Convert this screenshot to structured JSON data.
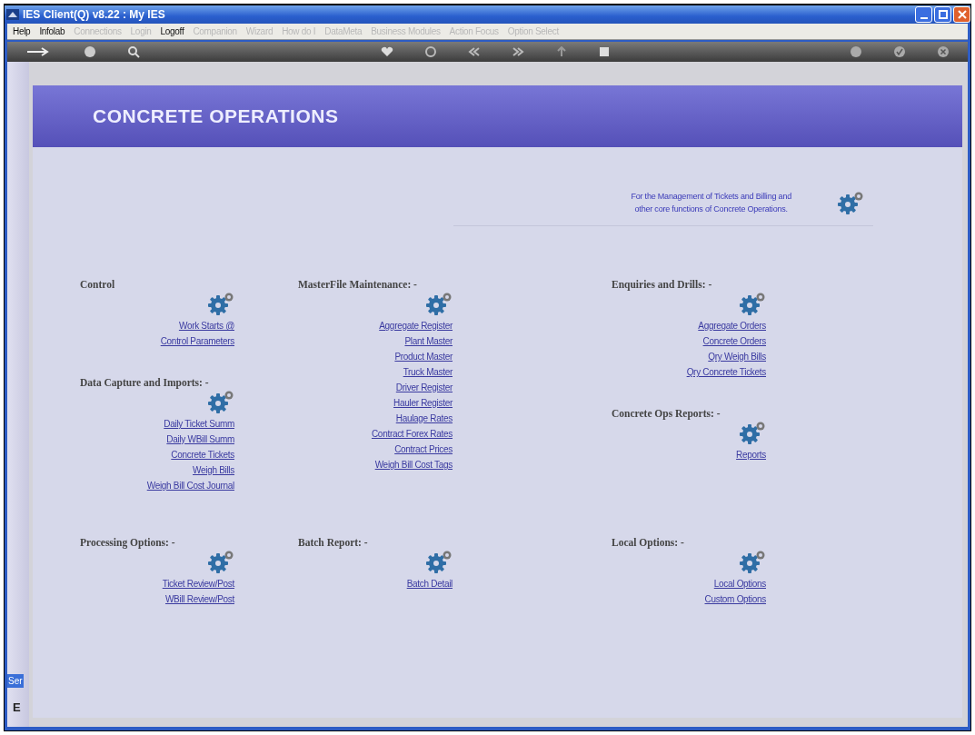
{
  "window": {
    "title": "IES Client(Q) v8.22 : My IES"
  },
  "menu": [
    {
      "label": "Help",
      "disabled": false
    },
    {
      "label": "Infolab",
      "disabled": false
    },
    {
      "label": "Connections",
      "disabled": true
    },
    {
      "label": "Login",
      "disabled": true
    },
    {
      "label": "Logoff",
      "disabled": false
    },
    {
      "label": "Companion",
      "disabled": true
    },
    {
      "label": "Wizard",
      "disabled": true
    },
    {
      "label": "How do I",
      "disabled": true
    },
    {
      "label": "DataMeta",
      "disabled": true
    },
    {
      "label": "Business Modules",
      "disabled": true
    },
    {
      "label": "Action Focus",
      "disabled": true
    },
    {
      "label": "Option Select",
      "disabled": true
    }
  ],
  "side_strip": {
    "tab": "Ser",
    "label": "E"
  },
  "header": {
    "title": "CONCRETE OPERATIONS"
  },
  "info": {
    "lines": [
      "For the Management of Tickets and Billing and",
      "other core functions of Concrete Operations."
    ]
  },
  "columns": [
    {
      "sections": [
        {
          "heading": "Control",
          "links": [
            "Work Starts @",
            "Control Parameters"
          ]
        },
        {
          "heading": "Data Capture and Imports: -",
          "links": [
            "Daily Ticket Summ",
            "Daily WBill Summ",
            "Concrete Tickets",
            "Weigh Bills",
            "Weigh Bill Cost Journal"
          ]
        }
      ]
    },
    {
      "sections": [
        {
          "heading": "MasterFile Maintenance: -",
          "links": [
            "Aggregate Register",
            "Plant Master",
            "Product Master",
            "Truck Master",
            "Driver Register",
            "Hauler Register",
            "Haulage Rates",
            "Contract Forex Rates",
            "Contract Prices",
            "Weigh Bill Cost Tags"
          ]
        }
      ]
    },
    {
      "sections": [
        {
          "heading": "Enquiries and Drills: -",
          "links": [
            "Aggregate Orders",
            "Concrete Orders",
            "Qry Weigh Bills",
            "Qry Concrete Tickets"
          ]
        },
        {
          "heading": "Concrete Ops Reports: -",
          "links": [
            "Reports"
          ]
        }
      ]
    }
  ],
  "bottom_sections": [
    {
      "heading": "Processing Options: -",
      "links": [
        "Ticket Review/Post",
        "WBill Review/Post"
      ]
    },
    {
      "heading": "Batch Report: -",
      "links": [
        "Batch Detail"
      ]
    },
    {
      "heading": "Local Options: -",
      "links": [
        "Local Options",
        "Custom Options"
      ]
    }
  ]
}
